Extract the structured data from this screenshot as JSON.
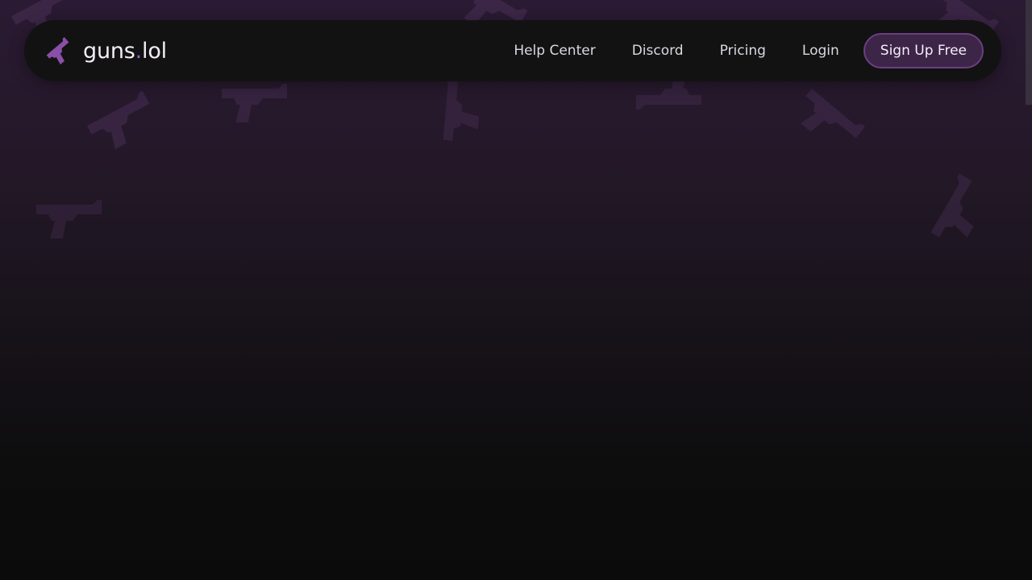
{
  "brand": {
    "name_main": "guns",
    "name_dot": ".",
    "name_tld": "lol",
    "logo_icon": "pistol-icon",
    "accent_color": "#a259c8"
  },
  "nav": {
    "links": [
      {
        "label": "Help Center"
      },
      {
        "label": "Discord"
      },
      {
        "label": "Pricing"
      },
      {
        "label": "Login"
      }
    ],
    "cta_label": "Sign Up Free"
  },
  "background": {
    "pattern_icon": "pistol-icon",
    "gradient_top": "#2a1a33",
    "gradient_bottom": "#0b0b0b"
  }
}
